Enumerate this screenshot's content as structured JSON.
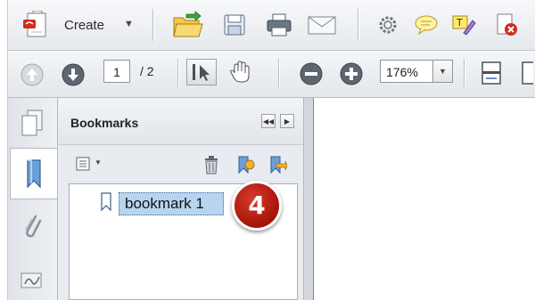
{
  "toolbar": {
    "create_label": "Create",
    "caret": "▼",
    "icons": [
      "create-pdf-icon",
      "open-folder-icon",
      "save-icon",
      "print-icon",
      "email-icon",
      "settings-icon",
      "comment-icon",
      "sign-icon",
      "delete-icon"
    ]
  },
  "navigation": {
    "current_page": "1",
    "total_pages": "/ 2",
    "zoom": "176%",
    "zoom_caret": "▼"
  },
  "bookmarks_panel": {
    "title": "Bookmarks",
    "options_caret": "▼",
    "items": [
      {
        "label": "bookmark 1",
        "selected": true
      }
    ]
  },
  "callout": {
    "step_number": "4"
  },
  "colors": {
    "selection": "#b9d4ee",
    "badge": "#b8190c"
  }
}
